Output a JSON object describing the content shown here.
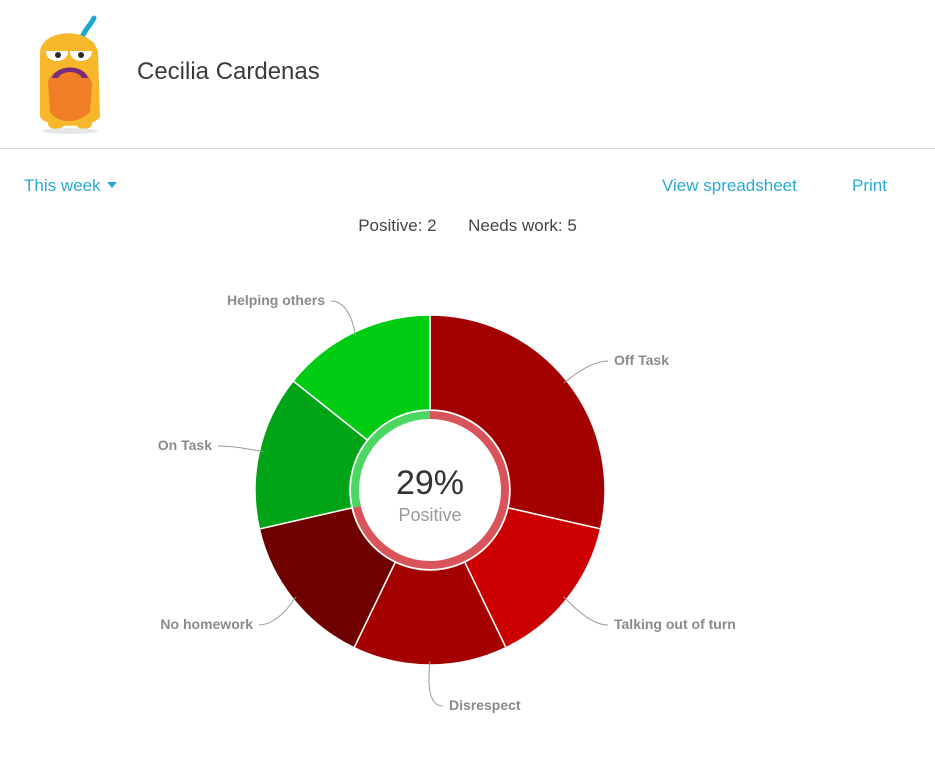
{
  "student": {
    "name": "Cecilia Cardenas"
  },
  "toolbar": {
    "range_label": "This week",
    "spreadsheet_label": "View spreadsheet",
    "print_label": "Print"
  },
  "summary": {
    "positive_label": "Positive:",
    "positive_count": "2",
    "needs_work_label": "Needs work:",
    "needs_work_count": "5"
  },
  "colors": {
    "accent": "#29a8d8",
    "positive_ring": "#4cd763",
    "negative_ring": "#d9535a"
  },
  "chart_data": {
    "type": "pie",
    "style": "donut",
    "center": {
      "value": "29%",
      "label": "Positive"
    },
    "slices": [
      {
        "label": "Off Task",
        "value": 2,
        "color": "#a30000"
      },
      {
        "label": "Talking out of turn",
        "value": 1,
        "color": "#cc0000"
      },
      {
        "label": "Disrespect",
        "value": 1,
        "color": "#a50000"
      },
      {
        "label": "No homework",
        "value": 1,
        "color": "#6e0000"
      },
      {
        "label": "On Task",
        "value": 1,
        "color": "#00a416"
      },
      {
        "label": "Helping others",
        "value": 1,
        "color": "#00cc14"
      }
    ],
    "positive_fraction": 0.286
  }
}
